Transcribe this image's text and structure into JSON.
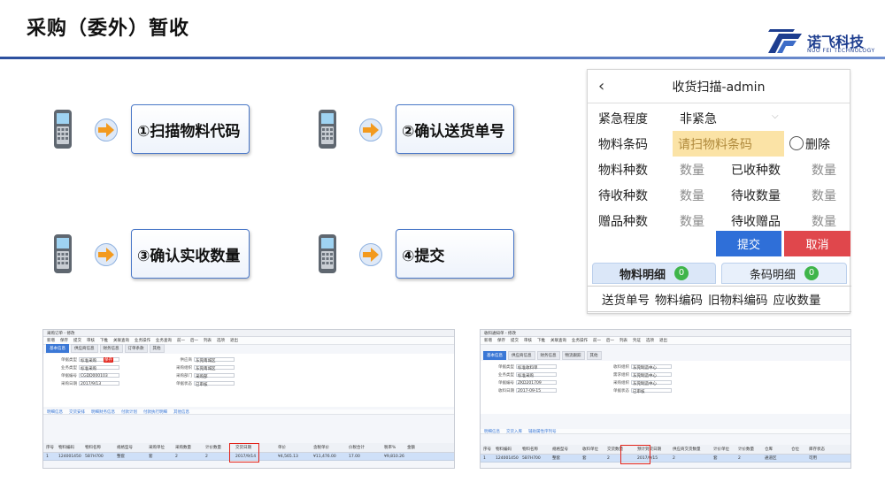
{
  "slide": {
    "title": "采购（委外）暂收"
  },
  "logo": {
    "name": "诺飞科技",
    "tagline": "NUO FEI TECHNOLOGY",
    "color": "#1d3d8f"
  },
  "steps": [
    {
      "label": "①扫描物料代码"
    },
    {
      "label": "②确认送货单号"
    },
    {
      "label": "③确认实收数量"
    },
    {
      "label": "④提交"
    }
  ],
  "mobile": {
    "title": "收货扫描-admin",
    "back_icon": "chevron-left-icon",
    "urgency_label": "紧急程度",
    "urgency_value": "非紧急",
    "barcode_label": "物料条码",
    "barcode_placeholder": "请扫物料条码",
    "delete_label": "删除",
    "item_kinds_label": "物料种数",
    "item_kinds_value": "数量",
    "received_kinds_label": "已收种数",
    "received_kinds_value": "数量",
    "pending_kinds_label": "待收种数",
    "pending_kinds_value": "数量",
    "pending_qty_label": "待收数量",
    "pending_qty_value": "数量",
    "gift_kinds_label": "赠品种数",
    "gift_kinds_value": "数量",
    "gift_qty_label": "待收赠品",
    "gift_qty_value": "数量",
    "submit_label": "提交",
    "cancel_label": "取消",
    "tab_items": "物料明细",
    "tab_items_count": "0",
    "tab_barcodes": "条码明细",
    "tab_barcodes_count": "0",
    "columns": [
      "送货单号",
      "物料编码",
      "旧物料编码",
      "应收数量"
    ],
    "colors": {
      "submit": "#2f6fd8",
      "cancel": "#e0474c",
      "highlight": "#fbe3a6",
      "count_badge": "#3fb54a"
    }
  },
  "erp_left": {
    "title": "采购订单 - 修改",
    "toolbar": [
      "新增",
      "保存",
      "提交",
      "审核",
      "下推",
      "关联查询",
      "业务操作",
      "业务查询",
      "前一",
      "后一",
      "列表",
      "选项",
      "退出"
    ],
    "tabs": [
      "基本信息",
      "供应商信息",
      "财务信息",
      "订单条款",
      "其他"
    ],
    "stamp": "保存",
    "fields": [
      {
        "label": "单据类型",
        "value": "标准采购"
      },
      {
        "label": "业务类型",
        "value": "标准采购"
      },
      {
        "label": "单据编号",
        "value": "CGDD000103"
      },
      {
        "label": "采购日期",
        "value": "2017/9/13"
      },
      {
        "label": "供应商",
        "value": "东莞南城区"
      },
      {
        "label": "采购组织",
        "value": "东莞南城区"
      },
      {
        "label": "采购部门",
        "value": "采购部"
      },
      {
        "label": "单据状态",
        "value": "已审核"
      }
    ],
    "subtabs": [
      "明细信息",
      "交货安排",
      "明细财务信息",
      "付款计划",
      "付款执行明细",
      "其他信息"
    ],
    "grid_head": [
      "序号",
      "物料编码",
      "物料名称",
      "规格型号",
      "采购单位",
      "采购数量",
      "计价数量",
      "交货日期",
      "单价",
      "含税单价",
      "价税合计",
      "税率%",
      "金额"
    ],
    "grid_row": [
      "1",
      "124001450",
      "5B7H700",
      "整套",
      "套",
      "2",
      "2",
      "2017/9/14",
      "¥4,565.13",
      "¥11,476.00",
      "17.00",
      "¥9,810.26"
    ]
  },
  "erp_right": {
    "title": "收料通知单 - 修改",
    "toolbar": [
      "新增",
      "保存",
      "提交",
      "审核",
      "下推",
      "关联查询",
      "业务操作",
      "前一",
      "后一",
      "列表",
      "凭证",
      "选项",
      "退出"
    ],
    "tabs": [
      "基本信息",
      "供应商信息",
      "财务信息",
      "物流跟踪",
      "其他"
    ],
    "fields": [
      {
        "label": "单据类型",
        "value": "标准收料单"
      },
      {
        "label": "业务类型",
        "value": "标准采购"
      },
      {
        "label": "单据编号",
        "value": "ZKD201709"
      },
      {
        "label": "收料日期",
        "value": "2017-09-15"
      },
      {
        "label": "收料组织",
        "value": "东莞制造中心"
      },
      {
        "label": "需求组织",
        "value": "东莞制造中心"
      },
      {
        "label": "采购组织",
        "value": "东莞制造中心"
      },
      {
        "label": "单据状态",
        "value": "已审核"
      }
    ],
    "subtabs": [
      "明细信息",
      "交货入库",
      "辅助属性序列号"
    ],
    "grid_head": [
      "序号",
      "物料编码",
      "物料名称",
      "规格型号",
      "收料单位",
      "交货数量",
      "预计到货日期",
      "供应商交货数量",
      "计价单位",
      "计价数量",
      "仓库",
      "仓位",
      "库存状态"
    ],
    "grid_row": [
      "1",
      "124001450",
      "5B7H700",
      "整套",
      "套",
      "2",
      "2017/9/15",
      "2",
      "套",
      "2",
      "通道区",
      "",
      "可用"
    ]
  }
}
